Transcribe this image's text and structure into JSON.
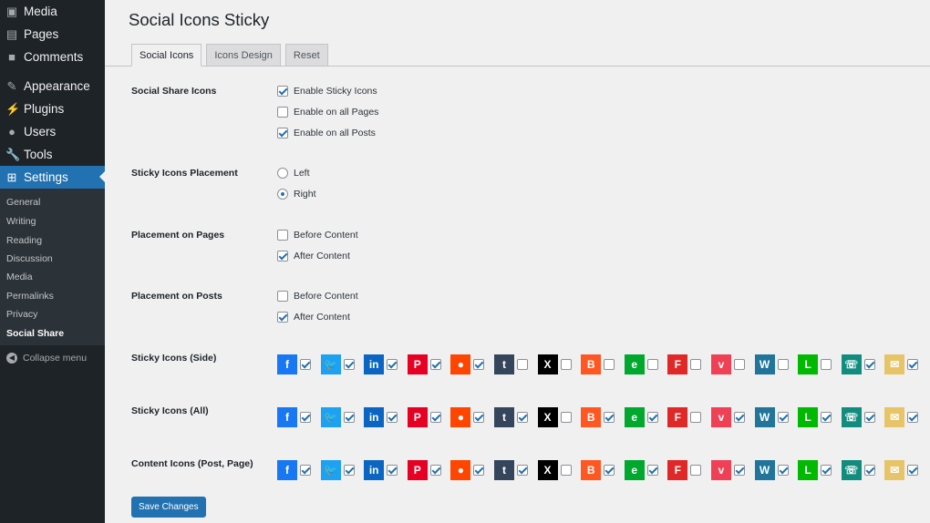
{
  "sidebar": {
    "items": [
      {
        "label": "Media",
        "icon": "media-icon"
      },
      {
        "label": "Pages",
        "icon": "pages-icon"
      },
      {
        "label": "Comments",
        "icon": "comments-icon"
      },
      {
        "label": "Appearance",
        "icon": "appearance-icon"
      },
      {
        "label": "Plugins",
        "icon": "plugins-icon"
      },
      {
        "label": "Users",
        "icon": "users-icon"
      },
      {
        "label": "Tools",
        "icon": "tools-icon"
      },
      {
        "label": "Settings",
        "icon": "settings-icon"
      }
    ],
    "submenu": [
      "General",
      "Writing",
      "Reading",
      "Discussion",
      "Media",
      "Permalinks",
      "Privacy",
      "Social Share"
    ],
    "collapse": "Collapse menu"
  },
  "page": {
    "title": "Social Icons Sticky",
    "tabs": [
      "Social Icons",
      "Icons Design",
      "Reset"
    ]
  },
  "sections": {
    "share": {
      "label": "Social Share Icons",
      "options": [
        {
          "label": "Enable Sticky Icons",
          "checked": true
        },
        {
          "label": "Enable on all Pages",
          "checked": false
        },
        {
          "label": "Enable on all Posts",
          "checked": true
        }
      ]
    },
    "placement": {
      "label": "Sticky Icons Placement",
      "options": [
        {
          "label": "Left",
          "checked": false
        },
        {
          "label": "Right",
          "checked": true
        }
      ]
    },
    "pages": {
      "label": "Placement on Pages",
      "options": [
        {
          "label": "Before Content",
          "checked": false
        },
        {
          "label": "After Content",
          "checked": true
        }
      ]
    },
    "posts": {
      "label": "Placement on Posts",
      "options": [
        {
          "label": "Before Content",
          "checked": false
        },
        {
          "label": "After Content",
          "checked": true
        }
      ]
    }
  },
  "networks": [
    {
      "name": "facebook",
      "glyph": "f",
      "color": "#1877f2"
    },
    {
      "name": "twitter",
      "glyph": "🐦",
      "color": "#1da1f2"
    },
    {
      "name": "linkedin",
      "glyph": "in",
      "color": "#0a66c2"
    },
    {
      "name": "pinterest",
      "glyph": "P",
      "color": "#e60023"
    },
    {
      "name": "reddit",
      "glyph": "●",
      "color": "#ff4500"
    },
    {
      "name": "tumblr",
      "glyph": "t",
      "color": "#35465c"
    },
    {
      "name": "x",
      "glyph": "X",
      "color": "#000000"
    },
    {
      "name": "blogger",
      "glyph": "B",
      "color": "#ff5722"
    },
    {
      "name": "evernote",
      "glyph": "e",
      "color": "#00a82d"
    },
    {
      "name": "flipboard",
      "glyph": "F",
      "color": "#e12828"
    },
    {
      "name": "pocket",
      "glyph": "v",
      "color": "#ef4056"
    },
    {
      "name": "wordpress",
      "glyph": "W",
      "color": "#21759b"
    },
    {
      "name": "line",
      "glyph": "L",
      "color": "#00b900"
    },
    {
      "name": "whatsapp",
      "glyph": "☏",
      "color": "#128c7e"
    },
    {
      "name": "email",
      "glyph": "✉",
      "color": "#e8c468"
    }
  ],
  "icon_rows": [
    {
      "label": "Sticky Icons (Side)",
      "checked": [
        true,
        true,
        true,
        true,
        true,
        false,
        false,
        false,
        false,
        false,
        false,
        false,
        false,
        true,
        true
      ]
    },
    {
      "label": "Sticky Icons (All)",
      "checked": [
        true,
        true,
        true,
        true,
        true,
        true,
        false,
        true,
        true,
        false,
        true,
        true,
        true,
        true,
        true
      ]
    },
    {
      "label": "Content Icons (Post, Page)",
      "checked": [
        true,
        true,
        true,
        true,
        true,
        true,
        false,
        true,
        true,
        false,
        true,
        true,
        true,
        true,
        true
      ]
    }
  ],
  "save_label": "Save Changes"
}
